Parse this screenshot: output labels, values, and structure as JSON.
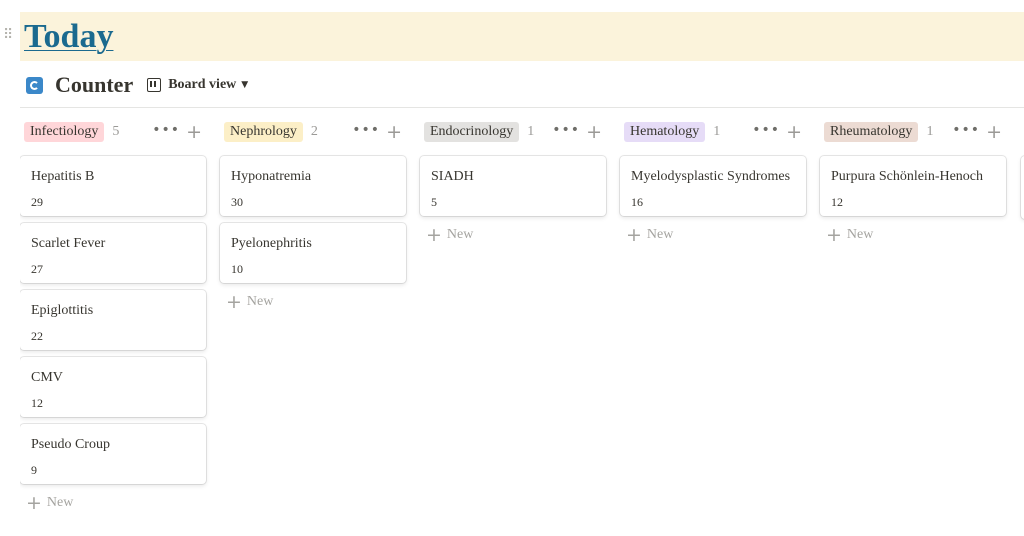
{
  "page": {
    "title": "Today"
  },
  "database": {
    "title": "Counter",
    "view_label": "Board view"
  },
  "columns": [
    {
      "label": "Infectiology",
      "count": "5",
      "tag_color": "#ffd6d9",
      "cards": [
        {
          "title": "Hepatitis B",
          "value": "29"
        },
        {
          "title": "Scarlet Fever",
          "value": "27"
        },
        {
          "title": "Epiglottitis",
          "value": "22"
        },
        {
          "title": "CMV",
          "value": "12"
        },
        {
          "title": "Pseudo Croup",
          "value": "9"
        }
      ]
    },
    {
      "label": "Nephrology",
      "count": "2",
      "tag_color": "#fcefc7",
      "cards": [
        {
          "title": "Hyponatremia",
          "value": "30"
        },
        {
          "title": "Pyelonephritis",
          "value": "10"
        }
      ]
    },
    {
      "label": "Endocrinology",
      "count": "1",
      "tag_color": "#e3e2e0",
      "cards": [
        {
          "title": "SIADH",
          "value": "5"
        }
      ]
    },
    {
      "label": "Hematology",
      "count": "1",
      "tag_color": "#e6dcf7",
      "cards": [
        {
          "title": "Myelodysplastic Syndromes",
          "value": "16"
        }
      ]
    },
    {
      "label": "Rheumatology",
      "count": "1",
      "tag_color": "#ecdbd3",
      "cards": [
        {
          "title": "Purpura Schönlein-Henoch",
          "value": "12"
        }
      ]
    }
  ],
  "new_label": "New",
  "colors": {
    "title": "#1b6a8f",
    "title_band": "#fbf3db",
    "db_icon": "#3b88c9"
  },
  "icons": {
    "drag": "drag-handle-icon",
    "db": "database-icon",
    "board": "board-view-icon",
    "more": "more-icon",
    "add": "plus-icon"
  }
}
